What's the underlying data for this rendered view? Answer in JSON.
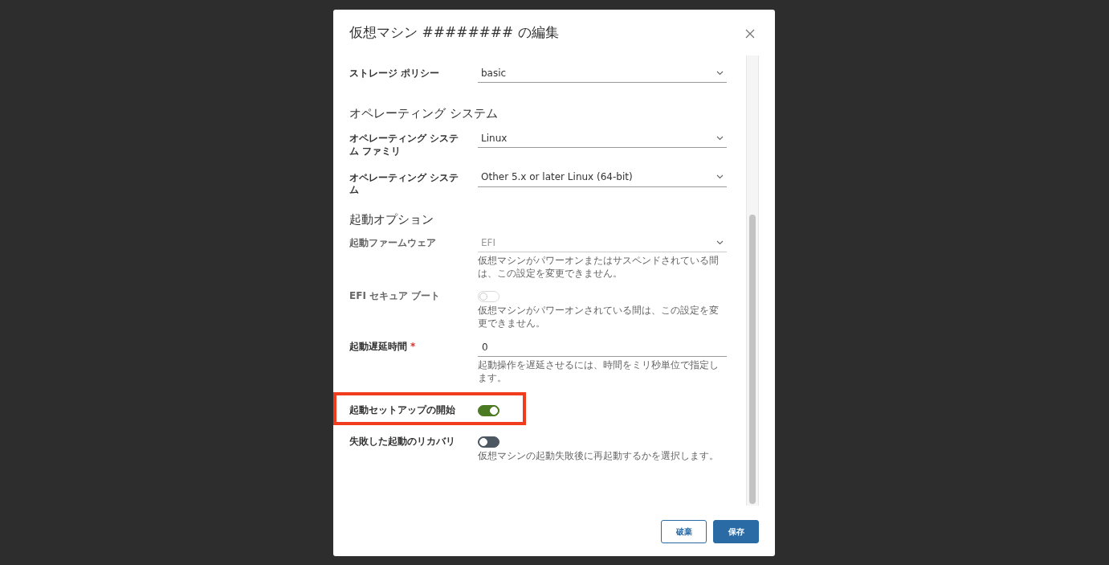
{
  "dialog": {
    "title": "仮想マシン ######## の編集",
    "items": [
      {
        "kind": "select",
        "label": "ストレージ ポリシー",
        "value": "basic"
      },
      {
        "kind": "heading",
        "text": "オペレーティング システム"
      },
      {
        "kind": "select",
        "label": "オペレーティング システム ファミリ",
        "value": "Linux"
      },
      {
        "kind": "select",
        "label": "オペレーティング システム",
        "value": "Other 5.x or later Linux (64-bit)"
      },
      {
        "kind": "heading",
        "text": "起動オプション"
      },
      {
        "kind": "select",
        "label": "起動ファームウェア",
        "value": "EFI",
        "disabled": true,
        "help": "仮想マシンがパワーオンまたはサスペンドされている間は、この設定を変更できません。"
      },
      {
        "kind": "toggle",
        "label": "EFI セキュア ブート",
        "on": false,
        "disabled": true,
        "help": "仮想マシンがパワーオンされている間は、この設定を変更できません。"
      },
      {
        "kind": "input",
        "label": "起動遅延時間",
        "required_mark": "*",
        "value": "0",
        "help": "起動操作を遅延させるには、時間をミリ秒単位で指定します。"
      },
      {
        "kind": "toggle",
        "label": "起動セットアップの開始",
        "on": true,
        "highlighted": true
      },
      {
        "kind": "toggle",
        "label": "失敗した起動のリカバリ",
        "on": false,
        "help": "仮想マシンの起動失敗後に再起動するかを選択します。"
      }
    ],
    "buttons": [
      {
        "label": "破棄",
        "kind": "outline"
      },
      {
        "label": "保存",
        "kind": "primary"
      }
    ]
  }
}
